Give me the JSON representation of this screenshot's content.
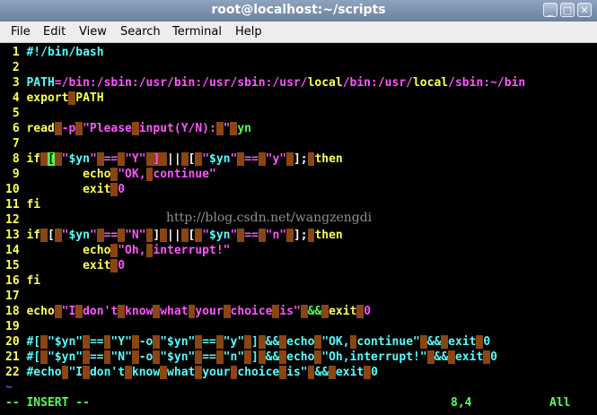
{
  "window": {
    "title": "root@localhost:~/scripts",
    "min": "_",
    "max": "□",
    "close": "✕"
  },
  "menu": [
    "File",
    "Edit",
    "View",
    "Search",
    "Terminal",
    "Help"
  ],
  "editor": {
    "lines": [
      {
        "n": "1",
        "segs": [
          [
            "#!/bin/bash",
            "cyan"
          ]
        ]
      },
      {
        "n": "2",
        "segs": []
      },
      {
        "n": "3",
        "segs": [
          [
            "PATH",
            "cyan"
          ],
          [
            "=/bin:/sbin:/usr/bin:/usr/sbin:/usr/",
            "magenta"
          ],
          [
            "local",
            "yellow"
          ],
          [
            "/bin:/usr/",
            "magenta"
          ],
          [
            "local",
            "yellow"
          ],
          [
            "/sbin:~/bin",
            "magenta"
          ]
        ]
      },
      {
        "n": "4",
        "segs": [
          [
            "export",
            "yellow"
          ],
          [
            " ",
            "hl"
          ],
          [
            "PATH",
            "yellow"
          ]
        ]
      },
      {
        "n": "5",
        "segs": []
      },
      {
        "n": "6",
        "segs": [
          [
            "read",
            "yellow"
          ],
          [
            " ",
            "hl"
          ],
          [
            "-p",
            "magenta"
          ],
          [
            " ",
            "hl"
          ],
          [
            "\"Please",
            "magenta"
          ],
          [
            " ",
            "hl"
          ],
          [
            "input(Y/N):",
            "magenta"
          ],
          [
            " ",
            "hl"
          ],
          [
            "\"",
            "magenta"
          ],
          [
            " ",
            "hl"
          ],
          [
            "yn",
            "green"
          ]
        ]
      },
      {
        "n": "7",
        "segs": []
      },
      {
        "n": "8",
        "segs": [
          [
            "if",
            "yellow"
          ],
          [
            " ",
            "hl"
          ],
          [
            "[",
            "cur"
          ],
          [
            " ",
            "hl"
          ],
          [
            "\"",
            "magenta"
          ],
          [
            "$yn",
            "cyan"
          ],
          [
            "\"",
            "magenta"
          ],
          [
            " ",
            "hl"
          ],
          [
            "==",
            "magenta"
          ],
          [
            " ",
            "hl"
          ],
          [
            "\"Y\"",
            "magenta"
          ],
          [
            " ",
            "hl"
          ],
          [
            "]",
            "hl"
          ],
          [
            " ",
            "hl"
          ],
          [
            "||",
            "white"
          ],
          [
            " ",
            "hl"
          ],
          [
            "[",
            "white"
          ],
          [
            " ",
            "hl"
          ],
          [
            "\"",
            "magenta"
          ],
          [
            "$yn",
            "cyan"
          ],
          [
            "\"",
            "magenta"
          ],
          [
            " ",
            "hl"
          ],
          [
            "==",
            "magenta"
          ],
          [
            " ",
            "hl"
          ],
          [
            "\"y\"",
            "magenta"
          ],
          [
            " ",
            "hl"
          ],
          [
            "];",
            "white"
          ],
          [
            " ",
            "hl"
          ],
          [
            "then",
            "yellow"
          ]
        ]
      },
      {
        "n": "9",
        "segs": [
          [
            "        echo",
            "yellow"
          ],
          [
            " ",
            "hl"
          ],
          [
            "\"OK,",
            "magenta"
          ],
          [
            " ",
            "hl"
          ],
          [
            "continue\"",
            "magenta"
          ]
        ]
      },
      {
        "n": "10",
        "segs": [
          [
            "        exit",
            "yellow"
          ],
          [
            " ",
            "hl"
          ],
          [
            "0",
            "magenta"
          ]
        ]
      },
      {
        "n": "11",
        "segs": [
          [
            "fi",
            "yellow"
          ]
        ]
      },
      {
        "n": "12",
        "segs": []
      },
      {
        "n": "13",
        "segs": [
          [
            "if",
            "yellow"
          ],
          [
            " ",
            "hl"
          ],
          [
            "[",
            "white"
          ],
          [
            " ",
            "hl"
          ],
          [
            "\"",
            "magenta"
          ],
          [
            "$yn",
            "cyan"
          ],
          [
            "\"",
            "magenta"
          ],
          [
            " ",
            "hl"
          ],
          [
            "==",
            "magenta"
          ],
          [
            " ",
            "hl"
          ],
          [
            "\"N\"",
            "magenta"
          ],
          [
            " ",
            "hl"
          ],
          [
            "]",
            "white"
          ],
          [
            " ",
            "hl"
          ],
          [
            "||",
            "white"
          ],
          [
            " ",
            "hl"
          ],
          [
            "[",
            "white"
          ],
          [
            " ",
            "hl"
          ],
          [
            "\"",
            "magenta"
          ],
          [
            "$yn",
            "cyan"
          ],
          [
            "\"",
            "magenta"
          ],
          [
            " ",
            "hl"
          ],
          [
            "==",
            "magenta"
          ],
          [
            " ",
            "hl"
          ],
          [
            "\"n\"",
            "magenta"
          ],
          [
            " ",
            "hl"
          ],
          [
            "];",
            "white"
          ],
          [
            " ",
            "hl"
          ],
          [
            "then",
            "yellow"
          ]
        ]
      },
      {
        "n": "14",
        "segs": [
          [
            "        echo",
            "yellow"
          ],
          [
            " ",
            "hl"
          ],
          [
            "\"Oh,",
            "magenta"
          ],
          [
            " ",
            "hl"
          ],
          [
            "interrupt!\"",
            "magenta"
          ]
        ]
      },
      {
        "n": "15",
        "segs": [
          [
            "        exit",
            "yellow"
          ],
          [
            " ",
            "hl"
          ],
          [
            "0",
            "magenta"
          ]
        ]
      },
      {
        "n": "16",
        "segs": [
          [
            "fi",
            "yellow"
          ]
        ]
      },
      {
        "n": "17",
        "segs": []
      },
      {
        "n": "18",
        "segs": [
          [
            "echo",
            "yellow"
          ],
          [
            " ",
            "hl"
          ],
          [
            "\"I",
            "magenta"
          ],
          [
            " ",
            "hl"
          ],
          [
            "don't",
            "magenta"
          ],
          [
            " ",
            "hl"
          ],
          [
            "know",
            "magenta"
          ],
          [
            " ",
            "hl"
          ],
          [
            "what",
            "magenta"
          ],
          [
            " ",
            "hl"
          ],
          [
            "your",
            "magenta"
          ],
          [
            " ",
            "hl"
          ],
          [
            "choice",
            "magenta"
          ],
          [
            " ",
            "hl"
          ],
          [
            "is\"",
            "magenta"
          ],
          [
            " ",
            "hl"
          ],
          [
            "&&",
            "green"
          ],
          [
            " ",
            "hl"
          ],
          [
            "exit",
            "yellow"
          ],
          [
            " ",
            "hl"
          ],
          [
            "0",
            "magenta"
          ]
        ]
      },
      {
        "n": "19",
        "segs": []
      },
      {
        "n": "20",
        "segs": [
          [
            "#[",
            "cyan"
          ],
          [
            " ",
            "hl"
          ],
          [
            "\"$yn\"",
            "cyan"
          ],
          [
            " ",
            "hl"
          ],
          [
            "==",
            "cyan"
          ],
          [
            " ",
            "hl"
          ],
          [
            "\"Y\"",
            "cyan"
          ],
          [
            " ",
            "hl"
          ],
          [
            "-o",
            "cyan"
          ],
          [
            " ",
            "hl"
          ],
          [
            "\"$yn\"",
            "cyan"
          ],
          [
            " ",
            "hl"
          ],
          [
            "==",
            "cyan"
          ],
          [
            " ",
            "hl"
          ],
          [
            "\"y\"",
            "cyan"
          ],
          [
            " ",
            "hl"
          ],
          [
            "]",
            "cyan"
          ],
          [
            " ",
            "hl"
          ],
          [
            "&&",
            "cyan"
          ],
          [
            " ",
            "hl"
          ],
          [
            "echo",
            "cyan"
          ],
          [
            " ",
            "hl"
          ],
          [
            "\"OK,",
            "cyan"
          ],
          [
            " ",
            "hl"
          ],
          [
            "continue\"",
            "cyan"
          ],
          [
            " ",
            "hl"
          ],
          [
            "&&",
            "cyan"
          ],
          [
            " ",
            "hl"
          ],
          [
            "exit",
            "cyan"
          ],
          [
            " ",
            "hl"
          ],
          [
            "0",
            "cyan"
          ]
        ]
      },
      {
        "n": "21",
        "segs": [
          [
            "#[",
            "cyan"
          ],
          [
            " ",
            "hl"
          ],
          [
            "\"$yn\"",
            "cyan"
          ],
          [
            " ",
            "hl"
          ],
          [
            "==",
            "cyan"
          ],
          [
            " ",
            "hl"
          ],
          [
            "\"N\"",
            "cyan"
          ],
          [
            " ",
            "hl"
          ],
          [
            "-o",
            "cyan"
          ],
          [
            " ",
            "hl"
          ],
          [
            "\"$yn\"",
            "cyan"
          ],
          [
            " ",
            "hl"
          ],
          [
            "==",
            "cyan"
          ],
          [
            " ",
            "hl"
          ],
          [
            "\"n\"",
            "cyan"
          ],
          [
            " ",
            "hl"
          ],
          [
            "]",
            "cyan"
          ],
          [
            " ",
            "hl"
          ],
          [
            "&&",
            "cyan"
          ],
          [
            " ",
            "hl"
          ],
          [
            "echo",
            "cyan"
          ],
          [
            " ",
            "hl"
          ],
          [
            "\"Oh,interrupt!\"",
            "cyan"
          ],
          [
            " ",
            "hl"
          ],
          [
            "&&",
            "cyan"
          ],
          [
            " ",
            "hl"
          ],
          [
            "exit",
            "cyan"
          ],
          [
            " ",
            "hl"
          ],
          [
            "0",
            "cyan"
          ]
        ]
      },
      {
        "n": "22",
        "segs": [
          [
            "#echo",
            "cyan"
          ],
          [
            " ",
            "hl"
          ],
          [
            "\"I",
            "cyan"
          ],
          [
            " ",
            "hl"
          ],
          [
            "don't",
            "cyan"
          ],
          [
            " ",
            "hl"
          ],
          [
            "know",
            "cyan"
          ],
          [
            " ",
            "hl"
          ],
          [
            "what",
            "cyan"
          ],
          [
            " ",
            "hl"
          ],
          [
            "your",
            "cyan"
          ],
          [
            " ",
            "hl"
          ],
          [
            "choice",
            "cyan"
          ],
          [
            " ",
            "hl"
          ],
          [
            "is\"",
            "cyan"
          ],
          [
            " ",
            "hl"
          ],
          [
            "&&",
            "cyan"
          ],
          [
            " ",
            "hl"
          ],
          [
            "exit",
            "cyan"
          ],
          [
            " ",
            "hl"
          ],
          [
            "0",
            "cyan"
          ]
        ]
      }
    ],
    "tilde": "~"
  },
  "watermark": "http://blog.csdn.net/wangzengdi",
  "status": {
    "mode": "-- INSERT --",
    "position": "8,4",
    "scroll": "All"
  }
}
